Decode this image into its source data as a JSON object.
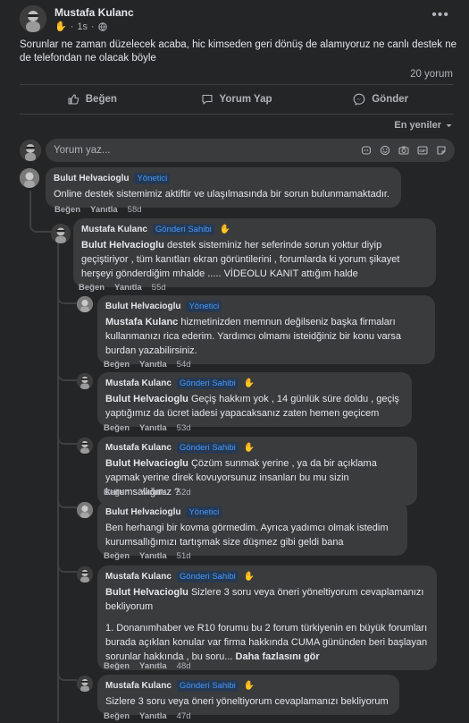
{
  "post": {
    "author": "Mustafa Kulanc",
    "time": "1s",
    "text": "Sorunlar ne zaman düzelecek acaba, hic kimseden geri dönüş de alamıyoruz ne canlı destek ne de telefondan ne olacak böyle",
    "comment_count": "20 yorum"
  },
  "actions": {
    "like": "Beğen",
    "comment": "Yorum Yap",
    "share": "Gönder"
  },
  "sort": {
    "label": "En yeniler"
  },
  "composer": {
    "placeholder": "Yorum yaz..."
  },
  "labels": {
    "like": "Beğen",
    "reply": "Yanıtla"
  },
  "comments": [
    {
      "name": "Bulut Helvacioglu",
      "badge": "Yönetici",
      "mention": "",
      "text": "Online destek sistemimiz aktiftir ve ulaşılmasında bir sorun bulunmamaktadır.",
      "time": "58d"
    },
    {
      "name": "Mustafa Kulanc",
      "badge": "Gönderi Sahibi",
      "mention": "Bulut Helvacioglu",
      "text": " destek sisteminiz her seferinde sorun yoktur diyip geçiştiriyor , tüm kanıtları ekran görüntilerini , forumlarda ki yorum şikayet herşeyi gönderdiğim mhalde ..... VİDEOLU KANIT attığım halde",
      "time": "55d"
    },
    {
      "name": "Bulut Helvacioglu",
      "badge": "Yönetici",
      "mention": "Mustafa Kulanc",
      "text": " hizmetinizden memnun değilseniz başka firmaları kullanmanızı rica ederim. Yardımcı olmamı isteidğiniz bir konu varsa burdan yazabilirsiniz.",
      "time": "54d"
    },
    {
      "name": "Mustafa Kulanc",
      "badge": "Gönderi Sahibi",
      "mention": "Bulut Helvacioglu",
      "text": " Geçiş hakkım yok , 14 günlük süre doldu , geçiş yaptığımız da ücret iadesi yapacaksanız zaten hemen geçicem",
      "time": "53d"
    },
    {
      "name": "Mustafa Kulanc",
      "badge": "Gönderi Sahibi",
      "mention": "Bulut Helvacioglu",
      "text": " Çözüm sunmak yerine , ya da bir açıklama yapmak yerine direk kovuyorsunuz insanları bu mu sizin kurumsallığınız ?",
      "time": "52d"
    },
    {
      "name": "Bulut Helvacioglu",
      "badge": "Yönetici",
      "mention": "",
      "text": "Ben herhangi bir kovma görmedim. Ayrıca yadımcı olmak istedim kurumsallığımızı tartışmak size düşmez gibi geldi bana",
      "time": "51d"
    },
    {
      "name": "Mustafa Kulanc",
      "badge": "Gönderi Sahibi",
      "mention": "Bulut Helvacioglu",
      "text": " Sizlere 3 soru veya öneri yöneltiyorum cevaplamanızı bekliyorum",
      "text2": "1. Donanımhaber ve R10 forumu bu 2 forum türkiyenin en büyük forumları burada açıklan konular var firma hakkında CUMA gününden beri başlayan sorunlar hakkında , bu soru...",
      "more": "Daha fazlasını gör",
      "time": "48d"
    },
    {
      "name": "Mustafa Kulanc",
      "badge": "Gönderi Sahibi",
      "mention": "",
      "text": "Sizlere 3 soru veya öneri yöneltiyorum cevaplamanızı bekliyorum",
      "time": "47d"
    }
  ]
}
